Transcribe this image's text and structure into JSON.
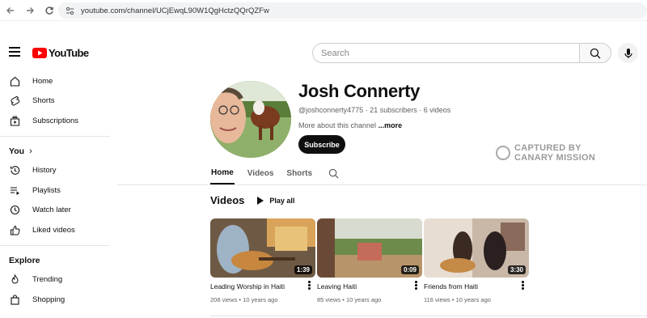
{
  "browser": {
    "url": "youtube.com/channel/UCjEwqL90W1QgHctzQQrQZFw"
  },
  "header": {
    "logo_text": "YouTube",
    "search_placeholder": "Search"
  },
  "sidebar": {
    "main": [
      {
        "label": "Home",
        "icon": "home-icon"
      },
      {
        "label": "Shorts",
        "icon": "shorts-icon"
      },
      {
        "label": "Subscriptions",
        "icon": "subscriptions-icon"
      }
    ],
    "you_label": "You",
    "you": [
      {
        "label": "History",
        "icon": "history-icon"
      },
      {
        "label": "Playlists",
        "icon": "playlists-icon"
      },
      {
        "label": "Watch later",
        "icon": "watch-later-icon"
      },
      {
        "label": "Liked videos",
        "icon": "thumbs-up-icon"
      }
    ],
    "explore_label": "Explore",
    "explore": [
      {
        "label": "Trending",
        "icon": "trending-icon"
      },
      {
        "label": "Shopping",
        "icon": "shopping-bag-icon"
      }
    ]
  },
  "channel": {
    "name": "Josh Connerty",
    "meta": "@joshconnerty4775 · 21 subscribers · 6 videos",
    "about": "More about this channel",
    "about_more": "...more",
    "subscribe": "Subscribe"
  },
  "watermark": {
    "line1": "CAPTURED BY",
    "line2": "CANARY MISSION"
  },
  "tabs": [
    "Home",
    "Videos",
    "Shorts"
  ],
  "section": {
    "title": "Videos",
    "play_all": "Play all"
  },
  "videos": [
    {
      "title": "Leading Worship in Haiti",
      "meta": "208 views • 10 years ago",
      "duration": "1:39"
    },
    {
      "title": "Leaving Haiti",
      "meta": "85 views • 10 years ago",
      "duration": "0:09"
    },
    {
      "title": "Friends from Haiti",
      "meta": "116 views • 10 years ago",
      "duration": "3:30"
    }
  ],
  "colors": {
    "brand_red": "#ff0000",
    "subscribe_bg": "#0f0f0f"
  }
}
